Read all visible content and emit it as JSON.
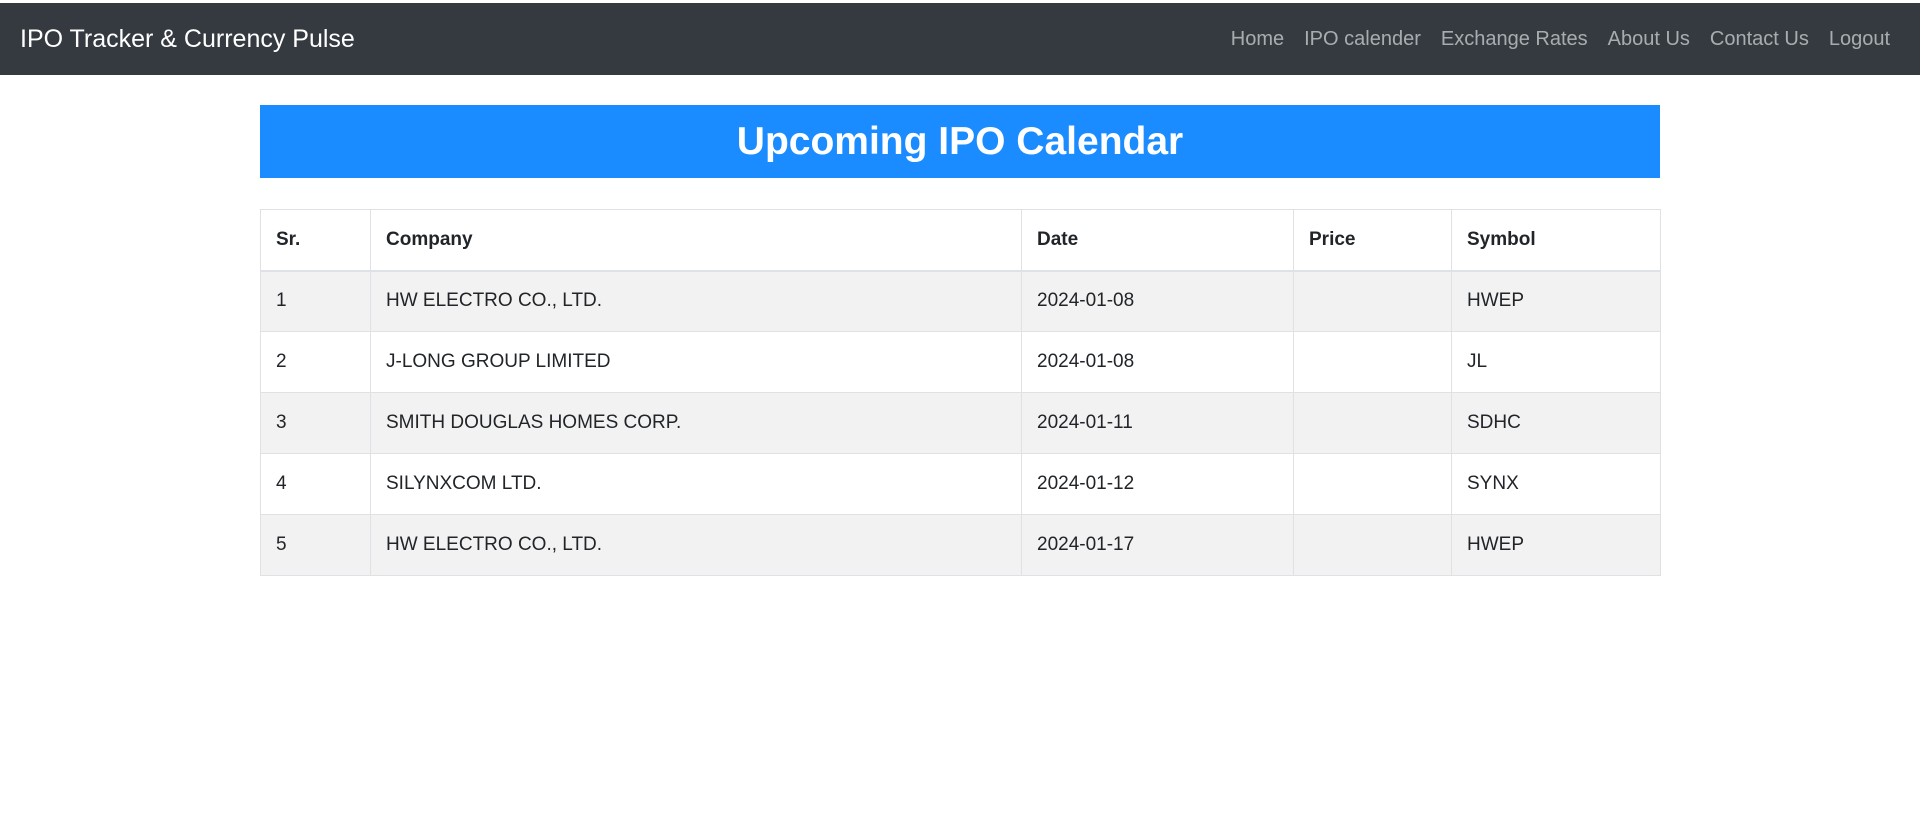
{
  "navbar": {
    "brand": "IPO Tracker & Currency Pulse",
    "links": [
      "Home",
      "IPO calender",
      "Exchange Rates",
      "About Us",
      "Contact Us",
      "Logout"
    ]
  },
  "main": {
    "title": "Upcoming IPO Calendar",
    "table": {
      "headers": [
        "Sr.",
        "Company",
        "Date",
        "Price",
        "Symbol"
      ],
      "rows": [
        [
          "1",
          "HW ELECTRO CO., LTD.",
          "2024-01-08",
          "",
          "HWEP"
        ],
        [
          "2",
          "J-LONG GROUP LIMITED",
          "2024-01-08",
          "",
          "JL"
        ],
        [
          "3",
          "SMITH DOUGLAS HOMES CORP.",
          "2024-01-11",
          "",
          "SDHC"
        ],
        [
          "4",
          "SILYNXCOM LTD.",
          "2024-01-12",
          "",
          "SYNX"
        ],
        [
          "5",
          "HW ELECTRO CO., LTD.",
          "2024-01-17",
          "",
          "HWEP"
        ]
      ]
    }
  },
  "colors": {
    "navbar_bg": "#343a40",
    "banner_bg": "#1a8cff",
    "stripe_bg": "#f2f2f2"
  }
}
